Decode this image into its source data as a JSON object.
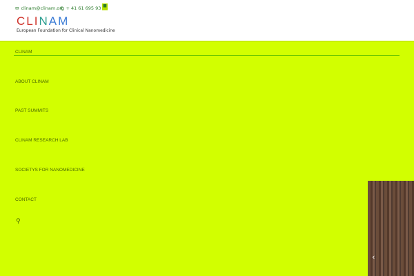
{
  "header": {
    "email": "clinam@clinam.org",
    "phone": "+ 41 61 695 93 95",
    "logo_letters": [
      "C",
      "L",
      "I",
      "N",
      "A",
      "M"
    ],
    "logo_colors": [
      "#d0342c",
      "#d0342c",
      "#d0342c",
      "#2a9d8f",
      "#3a7bd5",
      "#3a7bd5"
    ],
    "tagline": "European Foundation for Clinical Nanomedicine"
  },
  "nav": [
    "CLINAM",
    "ABOUT CLINAM",
    "PAST SUMMITS",
    "CLINAM RESEARCH LAB",
    "SOCIETYS FOR NANOMEDICINE",
    "CONTACT"
  ],
  "slider": {
    "prev_icon": "chevron-left-icon"
  }
}
